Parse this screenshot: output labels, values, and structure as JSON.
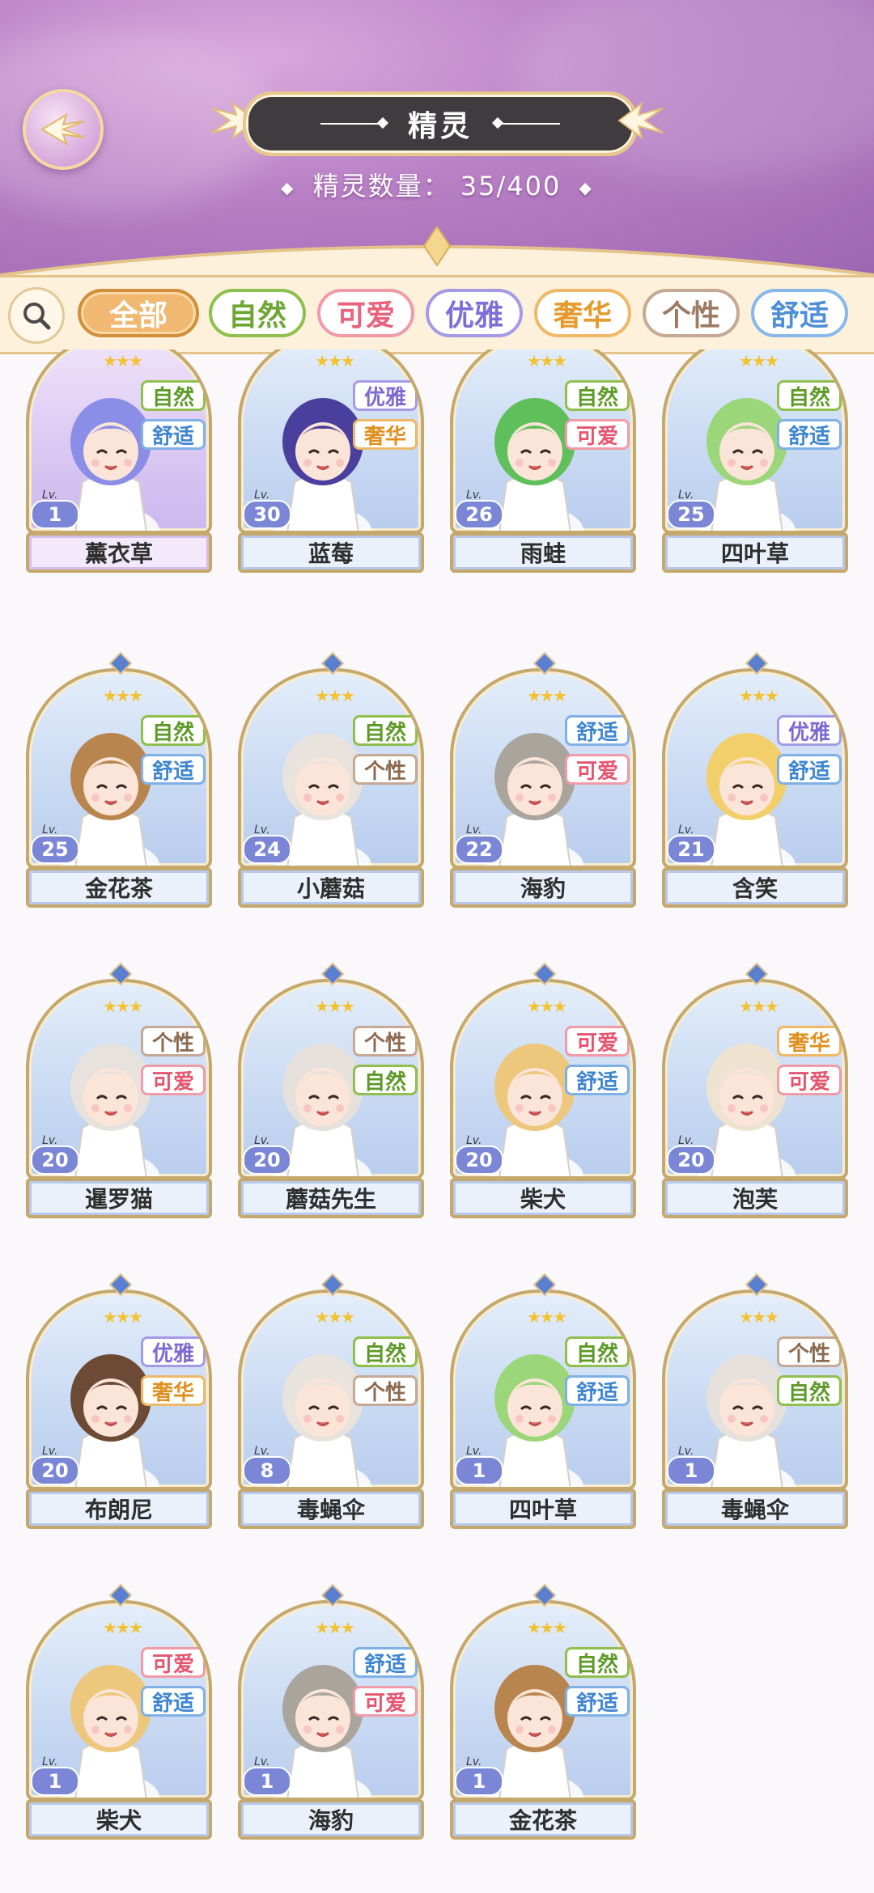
{
  "header": {
    "title": "精灵",
    "count_label": "精灵数量：",
    "count_value": "35/400"
  },
  "filters": [
    {
      "label": "全部",
      "active": true,
      "color": "#d08f3b",
      "text": "#ffffff"
    },
    {
      "label": "自然",
      "active": false,
      "color": "#8fbf4c",
      "text": "#6ea634"
    },
    {
      "label": "可爱",
      "active": false,
      "color": "#f19aa8",
      "text": "#e8647c"
    },
    {
      "label": "优雅",
      "active": false,
      "color": "#a59ae6",
      "text": "#7d6fd8"
    },
    {
      "label": "奢华",
      "active": false,
      "color": "#efb866",
      "text": "#e49a2c"
    },
    {
      "label": "个性",
      "active": false,
      "color": "#c5a995",
      "text": "#9b7b63"
    },
    {
      "label": "舒适",
      "active": false,
      "color": "#88b8ea",
      "text": "#4f8fd6"
    }
  ],
  "tag_colors": {
    "自然": {
      "border": "#8fbf4c",
      "text": "#5e9a28"
    },
    "舒适": {
      "border": "#7fb0e6",
      "text": "#3f86d0"
    },
    "优雅": {
      "border": "#a59ae6",
      "text": "#7a6ad2"
    },
    "奢华": {
      "border": "#efb866",
      "text": "#df9020"
    },
    "可爱": {
      "border": "#f19aa8",
      "text": "#e4566f"
    },
    "个性": {
      "border": "#c5a995",
      "text": "#8c6a50"
    }
  },
  "cards": [
    {
      "name": "薰衣草",
      "level": "1",
      "tags": [
        "自然",
        "舒适"
      ],
      "stars": 3,
      "theme": "purple",
      "hair": "#8a8ee6",
      "skin": "#fbe4d8"
    },
    {
      "name": "蓝莓",
      "level": "30",
      "tags": [
        "优雅",
        "奢华"
      ],
      "stars": 3,
      "theme": "blue",
      "hair": "#4a3f9c",
      "skin": "#fbe4d8"
    },
    {
      "name": "雨蛙",
      "level": "26",
      "tags": [
        "自然",
        "可爱"
      ],
      "stars": 3,
      "theme": "blue",
      "hair": "#5fbf5a",
      "skin": "#fbe4d8"
    },
    {
      "name": "四叶草",
      "level": "25",
      "tags": [
        "自然",
        "舒适"
      ],
      "stars": 3,
      "theme": "blue",
      "hair": "#9bd67a",
      "skin": "#fbe4d8"
    },
    {
      "name": "金花茶",
      "level": "25",
      "tags": [
        "自然",
        "舒适"
      ],
      "stars": 3,
      "theme": "blue",
      "hair": "#b9854e",
      "skin": "#fbe4d8"
    },
    {
      "name": "小蘑菇",
      "level": "24",
      "tags": [
        "自然",
        "个性"
      ],
      "stars": 3,
      "theme": "blue",
      "hair": "#e9e3de",
      "skin": "#fbe4d8"
    },
    {
      "name": "海豹",
      "level": "22",
      "tags": [
        "舒适",
        "可爱"
      ],
      "stars": 3,
      "theme": "blue",
      "hair": "#a9a49c",
      "skin": "#fbe4d8"
    },
    {
      "name": "含笑",
      "level": "21",
      "tags": [
        "优雅",
        "舒适"
      ],
      "stars": 3,
      "theme": "blue",
      "hair": "#f2cf6a",
      "skin": "#fbe4d8"
    },
    {
      "name": "暹罗猫",
      "level": "20",
      "tags": [
        "个性",
        "可爱"
      ],
      "stars": 3,
      "theme": "blue",
      "hair": "#e8e2de",
      "skin": "#fbe4d8"
    },
    {
      "name": "蘑菇先生",
      "level": "20",
      "tags": [
        "个性",
        "自然"
      ],
      "stars": 3,
      "theme": "blue",
      "hair": "#e6e1dc",
      "skin": "#fbe4d8"
    },
    {
      "name": "柴犬",
      "level": "20",
      "tags": [
        "可爱",
        "舒适"
      ],
      "stars": 3,
      "theme": "blue",
      "hair": "#ecc77c",
      "skin": "#fbe4d8"
    },
    {
      "name": "泡芙",
      "level": "20",
      "tags": [
        "奢华",
        "可爱"
      ],
      "stars": 3,
      "theme": "blue",
      "hair": "#ede3d0",
      "skin": "#fbe4d8"
    },
    {
      "name": "布朗尼",
      "level": "20",
      "tags": [
        "优雅",
        "奢华"
      ],
      "stars": 3,
      "theme": "blue",
      "hair": "#6d4a35",
      "skin": "#fbe4d8"
    },
    {
      "name": "毒蝇伞",
      "level": "8",
      "tags": [
        "自然",
        "个性"
      ],
      "stars": 3,
      "theme": "blue",
      "hair": "#e9e3de",
      "skin": "#fbe4d8"
    },
    {
      "name": "四叶草",
      "level": "1",
      "tags": [
        "自然",
        "舒适"
      ],
      "stars": 3,
      "theme": "blue",
      "hair": "#9bd67a",
      "skin": "#fbe4d8"
    },
    {
      "name": "毒蝇伞",
      "level": "1",
      "tags": [
        "个性",
        "自然"
      ],
      "stars": 3,
      "theme": "blue",
      "hair": "#e6e1dc",
      "skin": "#fbe4d8"
    },
    {
      "name": "柴犬",
      "level": "1",
      "tags": [
        "可爱",
        "舒适"
      ],
      "stars": 3,
      "theme": "blue",
      "hair": "#ecc77c",
      "skin": "#fbe4d8"
    },
    {
      "name": "海豹",
      "level": "1",
      "tags": [
        "舒适",
        "可爱"
      ],
      "stars": 3,
      "theme": "blue",
      "hair": "#a9a49c",
      "skin": "#fbe4d8"
    },
    {
      "name": "金花茶",
      "level": "1",
      "tags": [
        "自然",
        "舒适"
      ],
      "stars": 3,
      "theme": "blue",
      "hair": "#b9854e",
      "skin": "#fbe4d8"
    }
  ],
  "level_prefix": "Lv."
}
